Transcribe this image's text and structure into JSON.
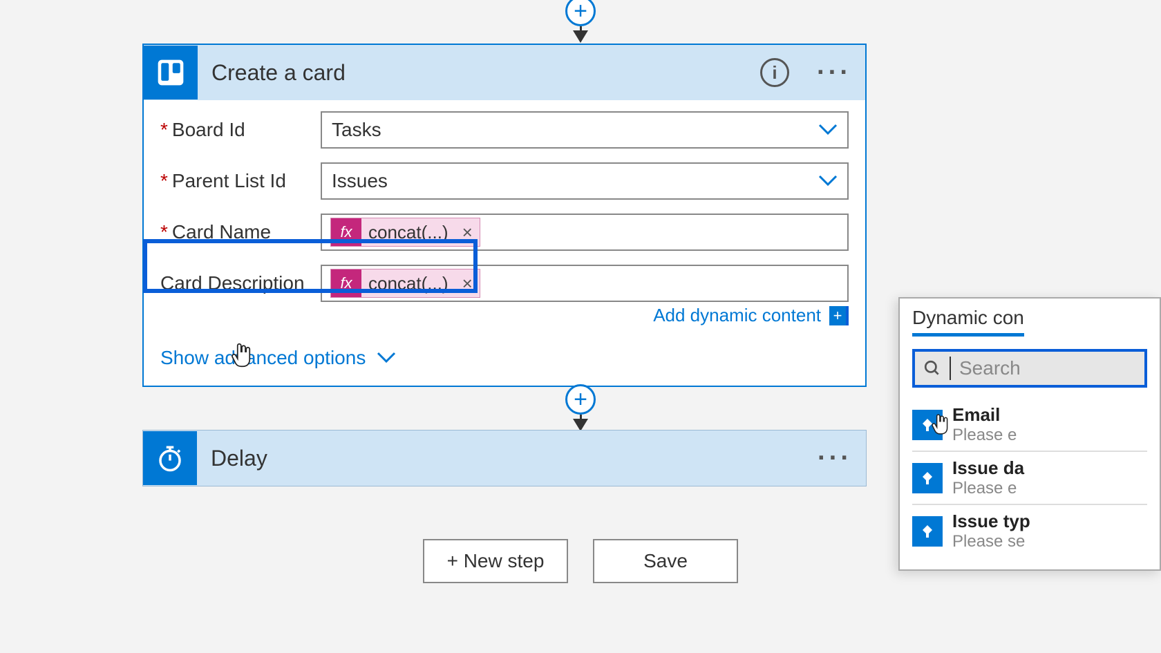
{
  "connector_plus": "+",
  "create_card": {
    "title": "Create a card",
    "info_glyph": "i",
    "ellipsis": "···",
    "fields": {
      "board_id": {
        "label": "Board Id",
        "value": "Tasks",
        "required": true
      },
      "parent_list_id": {
        "label": "Parent List Id",
        "value": "Issues",
        "required": true
      },
      "card_name": {
        "label": "Card Name",
        "token": "concat(...)",
        "required": true
      },
      "card_description": {
        "label": "Card Description",
        "token": "concat(...)",
        "required": false
      }
    },
    "token_fx_glyph": "fx",
    "token_close_glyph": "×",
    "add_dynamic_label": "Add dynamic content",
    "add_dynamic_plus": "+",
    "advanced_label": "Show advanced options"
  },
  "delay": {
    "title": "Delay",
    "ellipsis": "···"
  },
  "buttons": {
    "new_step": "+ New step",
    "save": "Save"
  },
  "flyout": {
    "tab_dynamic": "Dynamic con",
    "search_placeholder": "Search",
    "items": [
      {
        "title": "Email",
        "sub": "Please e"
      },
      {
        "title": "Issue da",
        "sub": "Please e"
      },
      {
        "title": "Issue typ",
        "sub": "Please se"
      }
    ]
  }
}
